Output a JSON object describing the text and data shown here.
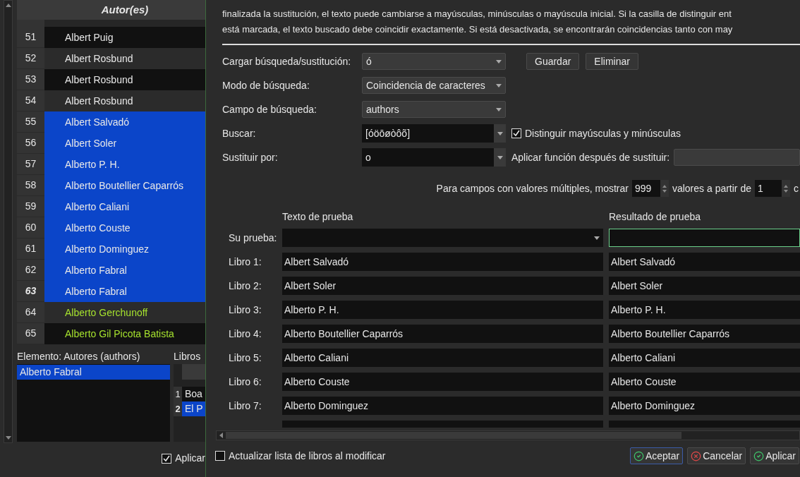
{
  "author_table": {
    "header": "Autor(es)",
    "rows": [
      {
        "number": "51",
        "name": "Albert Puig",
        "selected": false,
        "current": false,
        "flagged": false
      },
      {
        "number": "52",
        "name": "Albert Rosbund",
        "selected": false,
        "current": false,
        "flagged": false
      },
      {
        "number": "53",
        "name": "Albert Rosbund",
        "selected": false,
        "current": false,
        "flagged": false
      },
      {
        "number": "54",
        "name": "Albert Rosbund",
        "selected": false,
        "current": false,
        "flagged": false
      },
      {
        "number": "55",
        "name": "Albert Salvadó",
        "selected": true,
        "current": false,
        "flagged": false
      },
      {
        "number": "56",
        "name": "Albert Soler",
        "selected": true,
        "current": false,
        "flagged": false
      },
      {
        "number": "57",
        "name": "Alberto P. H.",
        "selected": true,
        "current": false,
        "flagged": false
      },
      {
        "number": "58",
        "name": "Alberto Boutellier Caparrós",
        "selected": true,
        "current": false,
        "flagged": false
      },
      {
        "number": "59",
        "name": "Alberto Caliani",
        "selected": true,
        "current": false,
        "flagged": false
      },
      {
        "number": "60",
        "name": "Alberto Couste",
        "selected": true,
        "current": false,
        "flagged": false
      },
      {
        "number": "61",
        "name": "Alberto Dominguez",
        "selected": true,
        "current": false,
        "flagged": false
      },
      {
        "number": "62",
        "name": "Alberto Fabral",
        "selected": true,
        "current": false,
        "flagged": false
      },
      {
        "number": "63",
        "name": "Alberto Fabral",
        "selected": true,
        "current": true,
        "flagged": false
      },
      {
        "number": "64",
        "name": "Alberto Gerchunoff",
        "selected": false,
        "current": false,
        "flagged": true
      },
      {
        "number": "65",
        "name": "Alberto Gil Picota Batista",
        "selected": false,
        "current": false,
        "flagged": true
      }
    ]
  },
  "element_panel": {
    "label": "Elemento: Autores (authors)",
    "items": [
      {
        "text": "Alberto Fabral",
        "selected": true
      }
    ]
  },
  "books_panel": {
    "label": "Libros",
    "rows": [
      {
        "number": "1",
        "title": "Boa",
        "selected": false,
        "current": false
      },
      {
        "number": "2",
        "title": "El P",
        "selected": true,
        "current": true
      }
    ]
  },
  "apply_checkbox": {
    "label": "Aplicar",
    "checked": true
  },
  "dialog": {
    "description": [
      "finalizada la sustitución, el texto puede cambiarse a mayúsculas, minúsculas o mayúscula inicial. Si la casilla de distinguir ent",
      "está marcada, el texto buscado debe coincidir exactamente. Si está desactivada, se encontrarán coincidencias tanto con may"
    ],
    "load": {
      "label": "Cargar búsqueda/sustitución:",
      "value": "ó",
      "buttons": [
        "Guardar",
        "Eliminar"
      ]
    },
    "mode": {
      "label": "Modo de búsqueda:",
      "value": "Coincidencia de caracteres"
    },
    "field": {
      "label": "Campo de búsqueda:",
      "value": "authors"
    },
    "search": {
      "label": "Buscar:",
      "value": "[óöōøòôõ]",
      "case_checkbox": {
        "label": "Distinguir mayúsculas y minúsculas",
        "checked": true
      }
    },
    "replace": {
      "label": "Sustituir por:",
      "value": "o",
      "function_label": "Aplicar función después de sustituir:"
    },
    "multi": {
      "text_1": "Para campos con valores múltiples, mostrar",
      "count": "999",
      "text_2": "valores a partir de",
      "start": "1",
      "text_3": "c"
    },
    "test": {
      "input_header": "Texto de prueba",
      "result_header": "Resultado de prueba",
      "your_test_label": "Su prueba:",
      "rows": [
        {
          "label": "Libro 1:",
          "input": "Albert Salvadó",
          "result": "Albert Salvadó"
        },
        {
          "label": "Libro 2:",
          "input": "Albert Soler",
          "result": "Albert Soler"
        },
        {
          "label": "Libro 3:",
          "input": "Alberto P. H.",
          "result": "Alberto P. H."
        },
        {
          "label": "Libro 4:",
          "input": "Alberto Boutellier Caparrós",
          "result": "Alberto Boutellier Caparrós"
        },
        {
          "label": "Libro 5:",
          "input": "Alberto Caliani",
          "result": "Alberto Caliani"
        },
        {
          "label": "Libro 6:",
          "input": "Alberto Couste",
          "result": "Alberto Couste"
        },
        {
          "label": "Libro 7:",
          "input": "Alberto Dominguez",
          "result": "Alberto Dominguez"
        }
      ]
    },
    "update_checkbox": {
      "label": "Actualizar lista de libros al modificar",
      "checked": false
    },
    "footer_buttons": [
      {
        "kind": "ok",
        "label": "Aceptar",
        "focused": true
      },
      {
        "kind": "cancel",
        "label": "Cancelar",
        "focused": false
      },
      {
        "kind": "apply",
        "label": "Aplicar",
        "focused": false
      }
    ]
  }
}
